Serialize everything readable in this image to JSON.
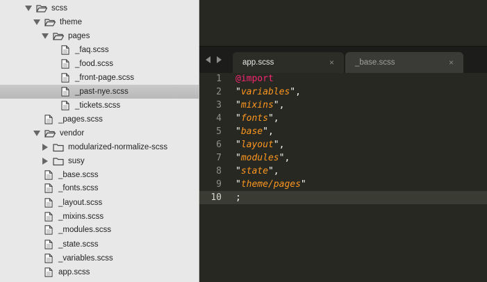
{
  "sidebar": {
    "tree": [
      {
        "label": "scss",
        "type": "folder",
        "expanded": true
      },
      {
        "label": "theme",
        "type": "folder",
        "expanded": true
      },
      {
        "label": "pages",
        "type": "folder",
        "expanded": true
      },
      {
        "label": "_faq.scss",
        "type": "file"
      },
      {
        "label": "_food.scss",
        "type": "file"
      },
      {
        "label": "_front-page.scss",
        "type": "file"
      },
      {
        "label": "_past-nye.scss",
        "type": "file",
        "selected": true
      },
      {
        "label": "_tickets.scss",
        "type": "file"
      },
      {
        "label": "_pages.scss",
        "type": "file"
      },
      {
        "label": "vendor",
        "type": "folder",
        "expanded": true
      },
      {
        "label": "modularized-normalize-scss",
        "type": "folder",
        "expanded": false
      },
      {
        "label": "susy",
        "type": "folder",
        "expanded": false
      },
      {
        "label": "_base.scss",
        "type": "file"
      },
      {
        "label": "_fonts.scss",
        "type": "file"
      },
      {
        "label": "_layout.scss",
        "type": "file"
      },
      {
        "label": "_mixins.scss",
        "type": "file"
      },
      {
        "label": "_modules.scss",
        "type": "file"
      },
      {
        "label": "_state.scss",
        "type": "file"
      },
      {
        "label": "_variables.scss",
        "type": "file"
      },
      {
        "label": "app.scss",
        "type": "file"
      }
    ]
  },
  "tabs": [
    {
      "label": "app.scss",
      "active": true,
      "close": "×"
    },
    {
      "label": "_base.scss",
      "active": false,
      "close": "×"
    }
  ],
  "editor": {
    "lines": [
      {
        "num": "1",
        "tokens": [
          {
            "t": "@import",
            "c": "kw"
          }
        ]
      },
      {
        "num": "2",
        "tokens": [
          {
            "t": "\"",
            "c": "p"
          },
          {
            "t": "variables",
            "c": "str"
          },
          {
            "t": "\",",
            "c": "p"
          }
        ]
      },
      {
        "num": "3",
        "tokens": [
          {
            "t": "\"",
            "c": "p"
          },
          {
            "t": "mixins",
            "c": "str"
          },
          {
            "t": "\",",
            "c": "p"
          }
        ]
      },
      {
        "num": "4",
        "tokens": [
          {
            "t": "\"",
            "c": "p"
          },
          {
            "t": "fonts",
            "c": "str"
          },
          {
            "t": "\",",
            "c": "p"
          }
        ]
      },
      {
        "num": "5",
        "tokens": [
          {
            "t": "\"",
            "c": "p"
          },
          {
            "t": "base",
            "c": "str"
          },
          {
            "t": "\",",
            "c": "p"
          }
        ]
      },
      {
        "num": "6",
        "tokens": [
          {
            "t": "\"",
            "c": "p"
          },
          {
            "t": "layout",
            "c": "str"
          },
          {
            "t": "\",",
            "c": "p"
          }
        ]
      },
      {
        "num": "7",
        "tokens": [
          {
            "t": "\"",
            "c": "p"
          },
          {
            "t": "modules",
            "c": "str"
          },
          {
            "t": "\",",
            "c": "p"
          }
        ]
      },
      {
        "num": "8",
        "tokens": [
          {
            "t": "\"",
            "c": "p"
          },
          {
            "t": "state",
            "c": "str"
          },
          {
            "t": "\",",
            "c": "p"
          }
        ]
      },
      {
        "num": "9",
        "tokens": [
          {
            "t": "\"",
            "c": "p"
          },
          {
            "t": "theme/pages",
            "c": "str"
          },
          {
            "t": "\"",
            "c": "p"
          }
        ]
      },
      {
        "num": "10",
        "tokens": [
          {
            "t": ";",
            "c": "p"
          }
        ],
        "current": true
      }
    ]
  },
  "colors": {
    "keyword": "#f92672",
    "string": "#fd971f",
    "plain": "#f8f8f2",
    "background": "#272822",
    "sidebar": "#e8e8e8"
  }
}
